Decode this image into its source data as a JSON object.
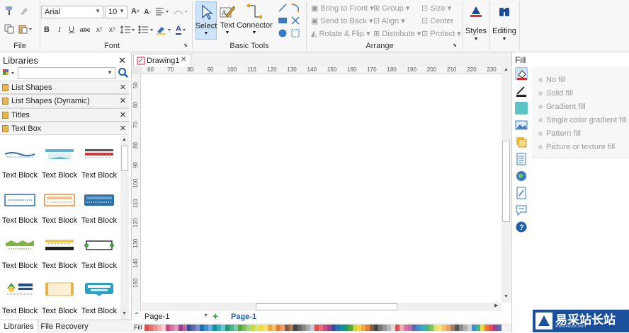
{
  "ribbon": {
    "file_group_label": "File",
    "font_group_label": "Font",
    "font_name": "Arial",
    "font_size": "10",
    "basic_tools_label": "Basic Tools",
    "select_label": "Select",
    "text_label": "Text",
    "connector_label": "Connector",
    "arrange_label": "Arrange",
    "bring_to_front": "Bring to Front",
    "send_to_back": "Send to Back",
    "rotate_flip": "Rotate & Flip",
    "group": "Group",
    "align": "Align",
    "distribute": "Distribute",
    "size": "Size",
    "center": "Center",
    "protect": "Protect",
    "styles_label": "Styles",
    "editing_label": "Editing"
  },
  "libraries": {
    "title": "Libraries",
    "categories": [
      "List Shapes",
      "List Shapes (Dynamic)",
      "Titles",
      "Text Box"
    ],
    "item_label": "Text Block",
    "bottom_tabs": [
      "Libraries",
      "File Recovery"
    ]
  },
  "document": {
    "tab_name": "Drawing1",
    "page_selector": "Page-1",
    "page_tab": "Page-1",
    "fill_label": "Fill"
  },
  "rulers": {
    "h": [
      "60",
      "70",
      "80",
      "90",
      "100",
      "110",
      "120",
      "130",
      "140",
      "150",
      "160",
      "170",
      "180",
      "190",
      "200",
      "210",
      "220",
      "230"
    ],
    "v": [
      "50",
      "60",
      "70",
      "80",
      "90",
      "100",
      "110",
      "120",
      "130",
      "140",
      "150"
    ]
  },
  "fill_panel": {
    "title": "Fill",
    "options": [
      "No fill",
      "Solid fill",
      "Gradient fill",
      "Single color gradient fill",
      "Pattern fill",
      "Picture or texture fill"
    ]
  },
  "watermark": {
    "text": "易采站长站",
    "sub": "www.easck.com"
  },
  "palette": [
    "#e64b4b",
    "#e8706f",
    "#ed8e8d",
    "#f2aeae",
    "#f6cfcf",
    "#c94d85",
    "#d872a0",
    "#e598bb",
    "#a23c8c",
    "#b968a8",
    "#3c4a9e",
    "#5b68b3",
    "#7f8bc6",
    "#1d6fb8",
    "#3c8fd0",
    "#6eadde",
    "#0e8fa3",
    "#34aebf",
    "#6cc7d2",
    "#1f9a6e",
    "#44b58b",
    "#79cca9",
    "#58a537",
    "#7cbf5a",
    "#a6d488",
    "#c6d83a",
    "#d8e46a",
    "#f4d73a",
    "#f7e26f",
    "#f2a93b",
    "#f5c06e",
    "#e97c2f",
    "#f0a066",
    "#8a5a3b",
    "#a87b5d",
    "#444444",
    "#666666",
    "#888888",
    "#aaaaaa",
    "#cccccc",
    "#e64b4b",
    "#e8706f",
    "#c94d85",
    "#a23c8c",
    "#3c4a9e",
    "#1d6fb8",
    "#0e8fa3",
    "#1f9a6e",
    "#58a537",
    "#c6d83a",
    "#f4d73a",
    "#f2a93b",
    "#e97c2f",
    "#8a5a3b",
    "#444444",
    "#777777",
    "#999999",
    "#bbbbbb",
    "#dddddd",
    "#e64b4b",
    "#f2aeae",
    "#d872a0",
    "#b968a8",
    "#5b68b3",
    "#3c8fd0",
    "#34aebf",
    "#44b58b",
    "#7cbf5a",
    "#d8e46a",
    "#f7e26f",
    "#f5c06e",
    "#f0a066",
    "#a87b5d",
    "#555555",
    "#888888",
    "#b0b0b0",
    "#d0d0d0",
    "#3c8fd0",
    "#44b58b",
    "#f4d73a",
    "#e97c2f",
    "#e64b4b",
    "#a23c8c",
    "#5b68b3"
  ]
}
